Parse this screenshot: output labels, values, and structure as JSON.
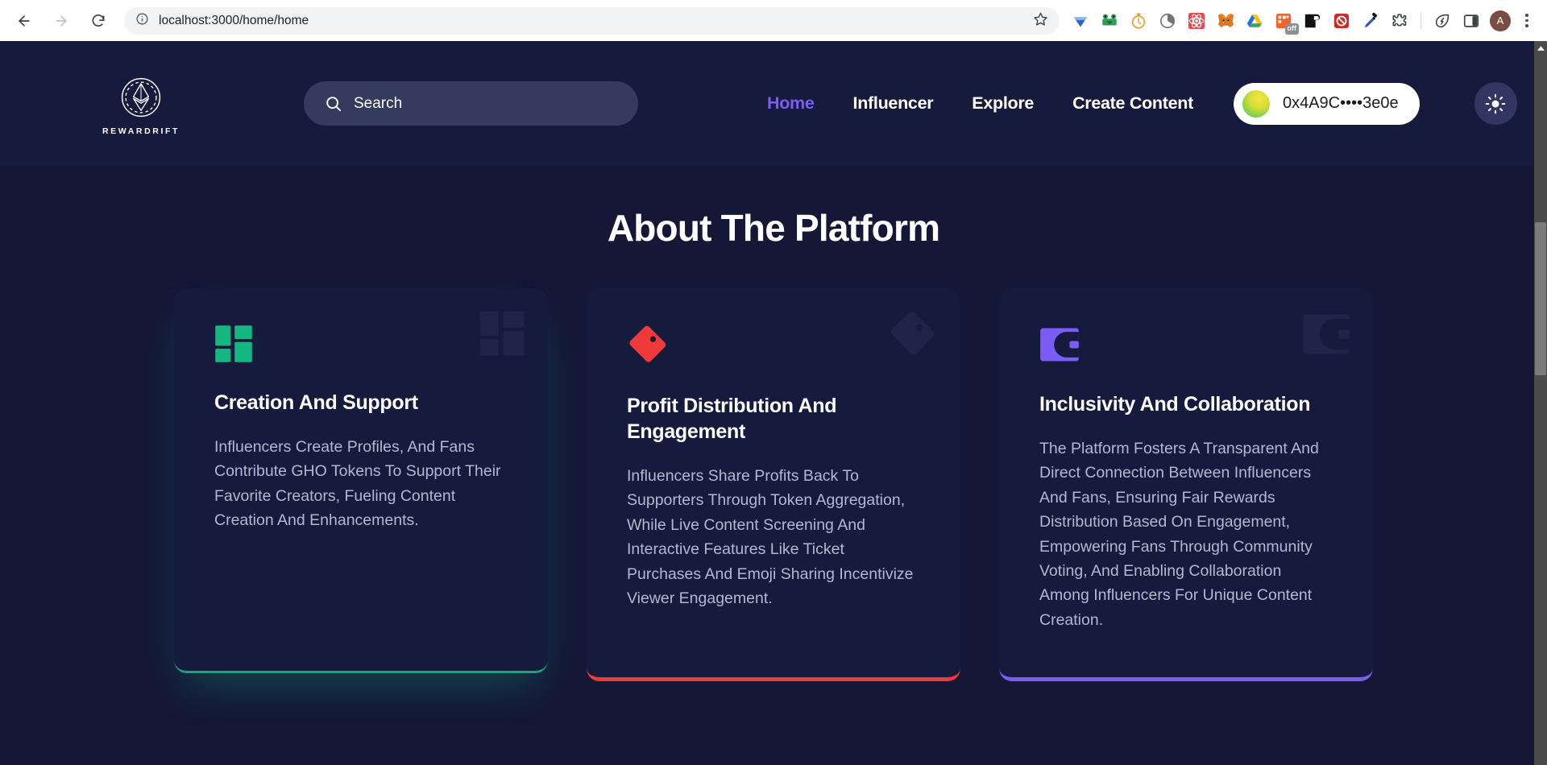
{
  "browser": {
    "url": "localhost:3000/home/home",
    "back_label": "Back",
    "forward_label": "Forward",
    "reload_label": "Reload",
    "site_info_label": "View site information",
    "bookmark_label": "Bookmark this tab",
    "extensions": [
      {
        "name": "diamond-extension-icon",
        "title": "Diamond"
      },
      {
        "name": "frog-extension-icon",
        "title": "Frog"
      },
      {
        "name": "stopwatch-extension-icon",
        "title": "Stopwatch"
      },
      {
        "name": "clock-extension-icon",
        "title": "Clock"
      },
      {
        "name": "react-devtools-extension-icon",
        "title": "React Developer Tools"
      },
      {
        "name": "metamask-extension-icon",
        "title": "MetaMask"
      },
      {
        "name": "google-drive-extension-icon",
        "title": "Google Drive"
      },
      {
        "name": "off-toggle-extension-icon",
        "title": "Off",
        "badge": "off"
      },
      {
        "name": "lock-extension-icon",
        "title": "Lock"
      },
      {
        "name": "shield-block-extension-icon",
        "title": "Shield"
      },
      {
        "name": "eyedropper-extension-icon",
        "title": "Color picker"
      },
      {
        "name": "puzzle-extensions-icon",
        "title": "Extensions"
      }
    ],
    "leaf_icon_label": "Leaf",
    "side_panel_label": "Side panel",
    "profile_initial": "A",
    "menu_label": "Customize and control"
  },
  "site": {
    "brand": {
      "name": "REWARDRIFT",
      "logo_label": "ethereum-diamond-logo"
    },
    "search": {
      "placeholder": "Search",
      "value": ""
    },
    "nav": [
      {
        "label": "Home",
        "active": true
      },
      {
        "label": "Influencer",
        "active": false
      },
      {
        "label": "Explore",
        "active": false
      },
      {
        "label": "Create Content",
        "active": false
      }
    ],
    "wallet": {
      "address": "0x4A9C••••3e0e"
    },
    "theme_toggle": {
      "mode": "sun",
      "label": "Toggle light mode"
    }
  },
  "main": {
    "section_title": "About The Platform",
    "cards": [
      {
        "title": "Creation And Support",
        "body": "Influencers Create Profiles, And Fans Contribute GHO Tokens To Support Their Favorite Creators, Fueling Content Creation And Enhancements.",
        "icon": "layout-grid-icon",
        "accent": "#11a97d"
      },
      {
        "title": "Profit Distribution And Engagement",
        "body": "Influencers Share Profits Back To Supporters Through Token Aggregation, While Live Content Screening And Interactive Features Like Ticket Purchases And Emoji Sharing Incentivize Viewer Engagement.",
        "icon": "price-tag-icon",
        "accent": "#f03a3a"
      },
      {
        "title": "Inclusivity And Collaboration",
        "body": "The Platform Fosters A Transparent And Direct Connection Between Influencers And Fans, Ensuring Fair Rewards Distribution Based On Engagement, Empowering Fans Through Community Voting, And Enabling Collaboration Among Influencers For Unique Content Creation.",
        "icon": "wallet-icon",
        "accent": "#7b5cf5"
      }
    ]
  },
  "colors": {
    "page_background": "#141735",
    "header_background": "#161a3c",
    "card_background": "#161a3d",
    "accent_purple": "#7b5cf5",
    "accent_green": "#11a97d",
    "accent_red": "#f03a3a",
    "body_text": "#b4b8ce"
  }
}
